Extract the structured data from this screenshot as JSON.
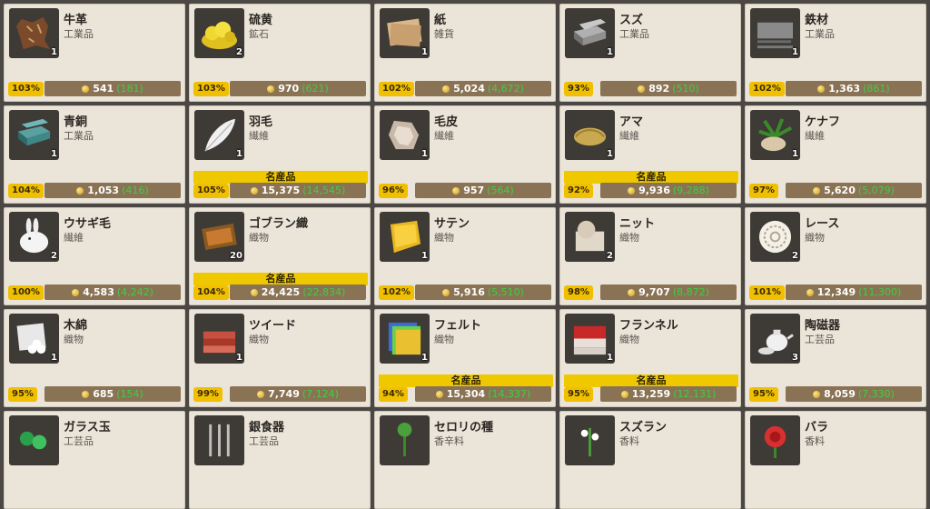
{
  "items": [
    {
      "name": "牛革",
      "category": "工業品",
      "qty": "1",
      "pct": "103%",
      "price": "541",
      "sub": "(181)",
      "icon": "leather-hide-icon",
      "famous": ""
    },
    {
      "name": "硫黄",
      "category": "鉱石",
      "qty": "2",
      "pct": "103%",
      "price": "970",
      "sub": "(621)",
      "icon": "sulfur-icon",
      "famous": ""
    },
    {
      "name": "紙",
      "category": "雑貨",
      "qty": "1",
      "pct": "102%",
      "price": "5,024",
      "sub": "(4,672)",
      "icon": "paper-icon",
      "famous": ""
    },
    {
      "name": "スズ",
      "category": "工業品",
      "qty": "1",
      "pct": "93%",
      "price": "892",
      "sub": "(510)",
      "icon": "tin-ingot-icon",
      "famous": ""
    },
    {
      "name": "鉄材",
      "category": "工業品",
      "qty": "1",
      "pct": "102%",
      "price": "1,363",
      "sub": "(861)",
      "icon": "iron-material-icon",
      "famous": ""
    },
    {
      "name": "青銅",
      "category": "工業品",
      "qty": "1",
      "pct": "104%",
      "price": "1,053",
      "sub": "(416)",
      "icon": "bronze-ingot-icon",
      "famous": ""
    },
    {
      "name": "羽毛",
      "category": "繊維",
      "qty": "1",
      "pct": "105%",
      "price": "15,375",
      "sub": "(14,545)",
      "icon": "feather-icon",
      "famous": "名産品"
    },
    {
      "name": "毛皮",
      "category": "繊維",
      "qty": "1",
      "pct": "96%",
      "price": "957",
      "sub": "(564)",
      "icon": "fur-icon",
      "famous": ""
    },
    {
      "name": "アマ",
      "category": "繊維",
      "qty": "1",
      "pct": "92%",
      "price": "9,936",
      "sub": "(9,288)",
      "icon": "flax-icon",
      "famous": "名産品"
    },
    {
      "name": "ケナフ",
      "category": "繊維",
      "qty": "1",
      "pct": "97%",
      "price": "5,620",
      "sub": "(5,079)",
      "icon": "kenaf-icon",
      "famous": ""
    },
    {
      "name": "ウサギ毛",
      "category": "繊維",
      "qty": "2",
      "pct": "100%",
      "price": "4,583",
      "sub": "(4,242)",
      "icon": "rabbit-icon",
      "famous": ""
    },
    {
      "name": "ゴブラン織",
      "category": "織物",
      "qty": "20",
      "pct": "104%",
      "price": "24,425",
      "sub": "(22,834)",
      "icon": "gobelin-icon",
      "famous": "名産品"
    },
    {
      "name": "サテン",
      "category": "織物",
      "qty": "1",
      "pct": "102%",
      "price": "5,916",
      "sub": "(5,510)",
      "icon": "satin-icon",
      "famous": ""
    },
    {
      "name": "ニット",
      "category": "織物",
      "qty": "2",
      "pct": "98%",
      "price": "9,707",
      "sub": "(8,872)",
      "icon": "knit-icon",
      "famous": ""
    },
    {
      "name": "レース",
      "category": "織物",
      "qty": "2",
      "pct": "101%",
      "price": "12,349",
      "sub": "(11,300)",
      "icon": "lace-icon",
      "famous": ""
    },
    {
      "name": "木綿",
      "category": "織物",
      "qty": "1",
      "pct": "95%",
      "price": "685",
      "sub": "(154)",
      "icon": "cotton-icon",
      "famous": ""
    },
    {
      "name": "ツイード",
      "category": "織物",
      "qty": "1",
      "pct": "99%",
      "price": "7,749",
      "sub": "(7,124)",
      "icon": "tweed-icon",
      "famous": ""
    },
    {
      "name": "フェルト",
      "category": "織物",
      "qty": "1",
      "pct": "94%",
      "price": "15,304",
      "sub": "(14,337)",
      "icon": "felt-icon",
      "famous": "名産品"
    },
    {
      "name": "フランネル",
      "category": "織物",
      "qty": "1",
      "pct": "95%",
      "price": "13,259",
      "sub": "(12,131)",
      "icon": "flannel-icon",
      "famous": "名産品"
    },
    {
      "name": "陶磁器",
      "category": "工芸品",
      "qty": "3",
      "pct": "95%",
      "price": "8,059",
      "sub": "(7,330)",
      "icon": "ceramics-icon",
      "famous": ""
    },
    {
      "name": "ガラス玉",
      "category": "工芸品",
      "qty": "",
      "pct": "",
      "price": "",
      "sub": "",
      "icon": "glass-beads-icon",
      "famous": ""
    },
    {
      "name": "銀食器",
      "category": "工芸品",
      "qty": "",
      "pct": "",
      "price": "",
      "sub": "",
      "icon": "silverware-icon",
      "famous": ""
    },
    {
      "name": "セロリの種",
      "category": "香辛料",
      "qty": "",
      "pct": "",
      "price": "",
      "sub": "",
      "icon": "celery-seed-icon",
      "famous": ""
    },
    {
      "name": "スズラン",
      "category": "香料",
      "qty": "",
      "pct": "",
      "price": "",
      "sub": "",
      "icon": "lily-of-valley-icon",
      "famous": ""
    },
    {
      "name": "バラ",
      "category": "香料",
      "qty": "",
      "pct": "",
      "price": "",
      "sub": "",
      "icon": "rose-icon",
      "famous": ""
    }
  ],
  "colors": {
    "card_bg": "#ebe4d8",
    "pct_badge": "#f0c000",
    "price_bar": "#8a7355",
    "sub_price": "#3cd040",
    "famous_badge": "#f0c800"
  }
}
